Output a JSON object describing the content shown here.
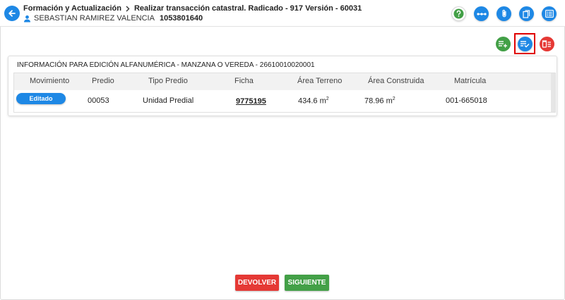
{
  "header": {
    "breadcrumb_root": "Formación y Actualización",
    "breadcrumb_current": "Realizar transacción catastral. Radicado - 917 Versión - 60031",
    "user_name": "SEBASTIAN RAMIREZ VALENCIA",
    "user_id": "1053801640",
    "icons": [
      "help-icon",
      "more-icon",
      "attachment-icon",
      "documents-icon",
      "list-icon"
    ]
  },
  "actions": {
    "icons": [
      "add-list-icon",
      "validate-list-icon",
      "delete-list-icon"
    ],
    "highlighted": "validate-list-icon"
  },
  "card": {
    "title": "INFORMACIÓN PARA EDICIÓN ALFANUMÉRICA - MANZANA O VEREDA - 26610010020001",
    "columns": [
      "Movimiento",
      "Predio",
      "Tipo Predio",
      "Ficha",
      "Área Terreno",
      "Área Construida",
      "Matrícula"
    ],
    "rows": [
      {
        "movimiento": "Editado",
        "predio": "00053",
        "tipo_predio": "Unidad Predial",
        "ficha": "9775195",
        "area_terreno": "434.6 m",
        "area_terreno_exp": "2",
        "area_construida": "78.96 m",
        "area_construida_exp": "2",
        "matricula": "001-665018"
      }
    ]
  },
  "footer": {
    "return_label": "DEVOLVER",
    "next_label": "SIGUIENTE"
  },
  "colors": {
    "primary": "#1e88e5",
    "success": "#43a047",
    "danger": "#e53935",
    "highlight": "#e00000"
  }
}
